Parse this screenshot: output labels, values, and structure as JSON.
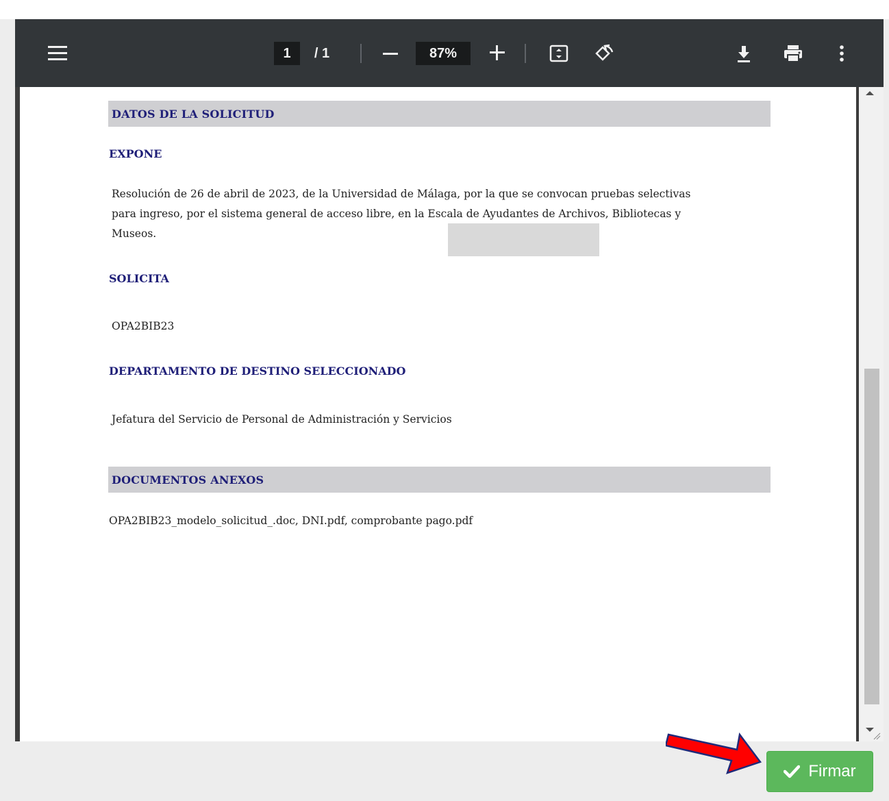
{
  "toolbar": {
    "current_page": "1",
    "page_total": "/ 1",
    "zoom": "87%",
    "icons": [
      "menu-icon",
      "zoom-out-icon",
      "zoom-in-icon",
      "fit-page-icon",
      "rotate-icon",
      "download-icon",
      "print-icon",
      "more-vert-icon"
    ]
  },
  "document": {
    "section_datos": "DATOS DE LA SOLICITUD",
    "expone_heading": "EXPONE",
    "expone_line1": "Resolución de 26 de abril de 2023, de la Universidad de Málaga, por la que se convocan pruebas selectivas",
    "expone_line2": "para ingreso, por el sistema general de acceso libre, en la Escala de Ayudantes de Archivos, Bibliotecas y",
    "expone_line3": "Museos.",
    "solicita_heading": "SOLICITA",
    "solicita_value": "OPA2BIB23",
    "departamento_heading": "DEPARTAMENTO DE DESTINO SELECCIONADO",
    "departamento_value": "Jefatura del Servicio de Personal de Administración y Servicios",
    "section_anexos": "DOCUMENTOS ANEXOS",
    "anexos_value": "OPA2BIB23_modelo_solicitud_.doc, DNI.pdf, comprobante pago.pdf"
  },
  "actions": {
    "firmar_label": "Firmar"
  },
  "colors": {
    "toolbar_bg": "#323639",
    "heading_color": "#1f1f78",
    "section_bar_bg": "#cfcfd2",
    "firmar_bg": "#5cb85c",
    "arrow_color": "#ff0000"
  }
}
